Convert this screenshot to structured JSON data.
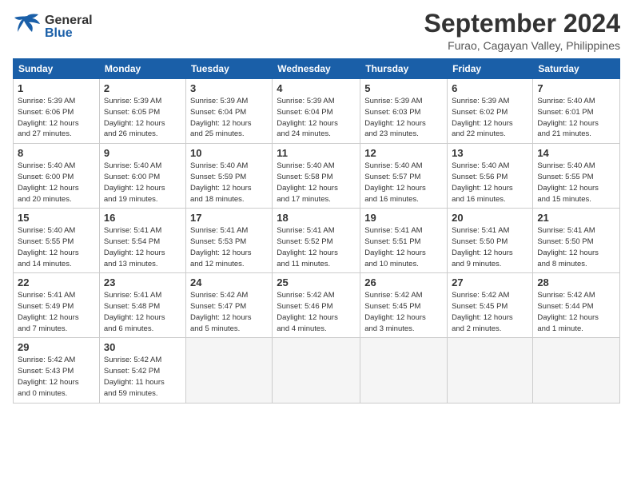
{
  "header": {
    "logo_general": "General",
    "logo_blue": "Blue",
    "title": "September 2024",
    "subtitle": "Furao, Cagayan Valley, Philippines"
  },
  "calendar": {
    "columns": [
      "Sunday",
      "Monday",
      "Tuesday",
      "Wednesday",
      "Thursday",
      "Friday",
      "Saturday"
    ],
    "rows": [
      [
        {
          "day": "1",
          "info": "Sunrise: 5:39 AM\nSunset: 6:06 PM\nDaylight: 12 hours\nand 27 minutes."
        },
        {
          "day": "2",
          "info": "Sunrise: 5:39 AM\nSunset: 6:05 PM\nDaylight: 12 hours\nand 26 minutes."
        },
        {
          "day": "3",
          "info": "Sunrise: 5:39 AM\nSunset: 6:04 PM\nDaylight: 12 hours\nand 25 minutes."
        },
        {
          "day": "4",
          "info": "Sunrise: 5:39 AM\nSunset: 6:04 PM\nDaylight: 12 hours\nand 24 minutes."
        },
        {
          "day": "5",
          "info": "Sunrise: 5:39 AM\nSunset: 6:03 PM\nDaylight: 12 hours\nand 23 minutes."
        },
        {
          "day": "6",
          "info": "Sunrise: 5:39 AM\nSunset: 6:02 PM\nDaylight: 12 hours\nand 22 minutes."
        },
        {
          "day": "7",
          "info": "Sunrise: 5:40 AM\nSunset: 6:01 PM\nDaylight: 12 hours\nand 21 minutes."
        }
      ],
      [
        {
          "day": "8",
          "info": "Sunrise: 5:40 AM\nSunset: 6:00 PM\nDaylight: 12 hours\nand 20 minutes."
        },
        {
          "day": "9",
          "info": "Sunrise: 5:40 AM\nSunset: 6:00 PM\nDaylight: 12 hours\nand 19 minutes."
        },
        {
          "day": "10",
          "info": "Sunrise: 5:40 AM\nSunset: 5:59 PM\nDaylight: 12 hours\nand 18 minutes."
        },
        {
          "day": "11",
          "info": "Sunrise: 5:40 AM\nSunset: 5:58 PM\nDaylight: 12 hours\nand 17 minutes."
        },
        {
          "day": "12",
          "info": "Sunrise: 5:40 AM\nSunset: 5:57 PM\nDaylight: 12 hours\nand 16 minutes."
        },
        {
          "day": "13",
          "info": "Sunrise: 5:40 AM\nSunset: 5:56 PM\nDaylight: 12 hours\nand 16 minutes."
        },
        {
          "day": "14",
          "info": "Sunrise: 5:40 AM\nSunset: 5:55 PM\nDaylight: 12 hours\nand 15 minutes."
        }
      ],
      [
        {
          "day": "15",
          "info": "Sunrise: 5:40 AM\nSunset: 5:55 PM\nDaylight: 12 hours\nand 14 minutes."
        },
        {
          "day": "16",
          "info": "Sunrise: 5:41 AM\nSunset: 5:54 PM\nDaylight: 12 hours\nand 13 minutes."
        },
        {
          "day": "17",
          "info": "Sunrise: 5:41 AM\nSunset: 5:53 PM\nDaylight: 12 hours\nand 12 minutes."
        },
        {
          "day": "18",
          "info": "Sunrise: 5:41 AM\nSunset: 5:52 PM\nDaylight: 12 hours\nand 11 minutes."
        },
        {
          "day": "19",
          "info": "Sunrise: 5:41 AM\nSunset: 5:51 PM\nDaylight: 12 hours\nand 10 minutes."
        },
        {
          "day": "20",
          "info": "Sunrise: 5:41 AM\nSunset: 5:50 PM\nDaylight: 12 hours\nand 9 minutes."
        },
        {
          "day": "21",
          "info": "Sunrise: 5:41 AM\nSunset: 5:50 PM\nDaylight: 12 hours\nand 8 minutes."
        }
      ],
      [
        {
          "day": "22",
          "info": "Sunrise: 5:41 AM\nSunset: 5:49 PM\nDaylight: 12 hours\nand 7 minutes."
        },
        {
          "day": "23",
          "info": "Sunrise: 5:41 AM\nSunset: 5:48 PM\nDaylight: 12 hours\nand 6 minutes."
        },
        {
          "day": "24",
          "info": "Sunrise: 5:42 AM\nSunset: 5:47 PM\nDaylight: 12 hours\nand 5 minutes."
        },
        {
          "day": "25",
          "info": "Sunrise: 5:42 AM\nSunset: 5:46 PM\nDaylight: 12 hours\nand 4 minutes."
        },
        {
          "day": "26",
          "info": "Sunrise: 5:42 AM\nSunset: 5:45 PM\nDaylight: 12 hours\nand 3 minutes."
        },
        {
          "day": "27",
          "info": "Sunrise: 5:42 AM\nSunset: 5:45 PM\nDaylight: 12 hours\nand 2 minutes."
        },
        {
          "day": "28",
          "info": "Sunrise: 5:42 AM\nSunset: 5:44 PM\nDaylight: 12 hours\nand 1 minute."
        }
      ],
      [
        {
          "day": "29",
          "info": "Sunrise: 5:42 AM\nSunset: 5:43 PM\nDaylight: 12 hours\nand 0 minutes."
        },
        {
          "day": "30",
          "info": "Sunrise: 5:42 AM\nSunset: 5:42 PM\nDaylight: 11 hours\nand 59 minutes."
        },
        {
          "day": "",
          "info": ""
        },
        {
          "day": "",
          "info": ""
        },
        {
          "day": "",
          "info": ""
        },
        {
          "day": "",
          "info": ""
        },
        {
          "day": "",
          "info": ""
        }
      ]
    ]
  }
}
